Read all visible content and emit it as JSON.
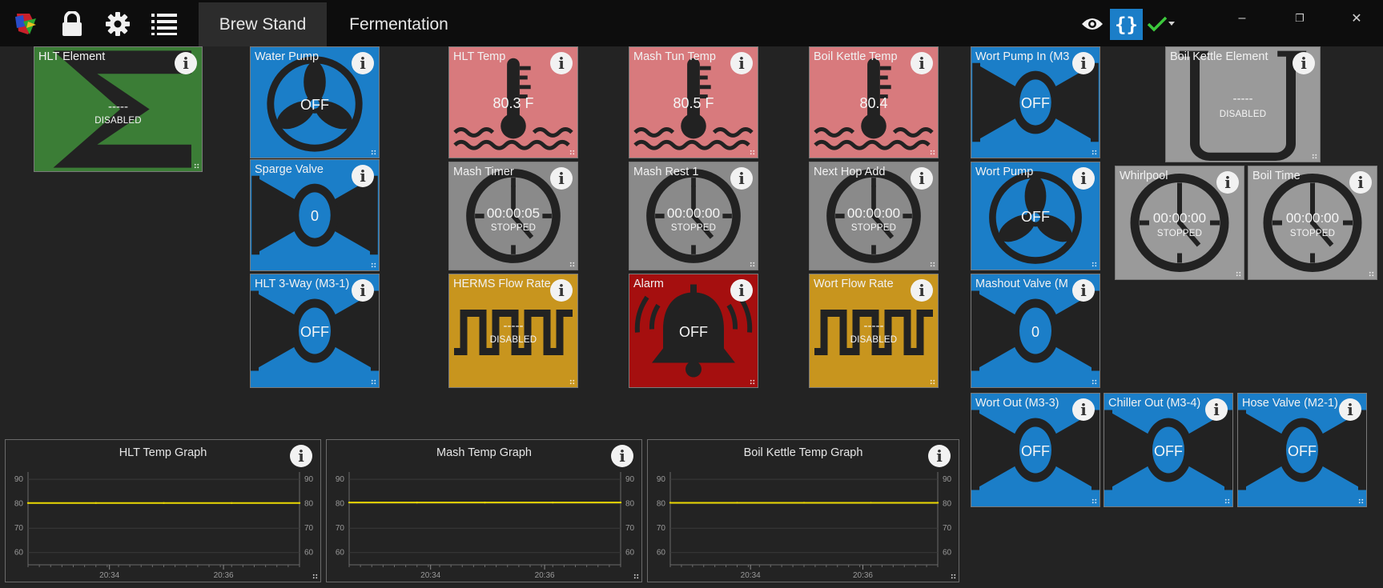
{
  "topbar": {
    "tabs": [
      {
        "label": "Brew Stand",
        "active": true
      },
      {
        "label": "Fermentation",
        "active": false
      }
    ],
    "icons": [
      "app-logo-icon",
      "lock-icon",
      "gear-icon",
      "list-icon",
      "eye-icon",
      "braces-icon",
      "checkmark-icon",
      "caret-down-icon"
    ],
    "window_controls": {
      "minimize": "–",
      "restore": "❐",
      "close": "✕"
    }
  },
  "colors": {
    "blue": "#1b7ec8",
    "pink": "#d87a7d",
    "gray": "#8a8a8a",
    "gold": "#c8951e",
    "red": "#a50f0f",
    "green": "#3b7d36",
    "light_gray": "#9a9a9a",
    "series": "#e8d600"
  },
  "tiles": {
    "hlt_element": {
      "name": "HLT Element",
      "value": "-----",
      "status": "DISABLED"
    },
    "water_pump": {
      "name": "Water Pump",
      "value": "OFF"
    },
    "hlt_temp": {
      "name": "HLT Temp",
      "value": "80.3 F"
    },
    "mash_tun_temp": {
      "name": "Mash Tun Temp",
      "value": "80.5 F"
    },
    "boil_kettle_temp": {
      "name": "Boil Kettle Temp",
      "value": "80.4"
    },
    "wort_pump_in": {
      "name": "Wort Pump In (M3",
      "value": "OFF"
    },
    "boil_kettle_element": {
      "name": "Boil Kettle Element",
      "value": "-----",
      "status": "DISABLED"
    },
    "sparge_valve": {
      "name": "Sparge Valve",
      "value": "0"
    },
    "mash_timer": {
      "name": "Mash Timer",
      "value": "00:00:05",
      "status": "STOPPED"
    },
    "mash_rest_1": {
      "name": "Mash Rest 1",
      "value": "00:00:00",
      "status": "STOPPED"
    },
    "next_hop_add": {
      "name": "Next Hop Add",
      "value": "00:00:00",
      "status": "STOPPED"
    },
    "wort_pump": {
      "name": "Wort Pump",
      "value": "OFF"
    },
    "whirlpool": {
      "name": "Whirlpool",
      "value": "00:00:00",
      "status": "STOPPED"
    },
    "boil_time": {
      "name": "Boil Time",
      "value": "00:00:00",
      "status": "STOPPED"
    },
    "hlt_3way": {
      "name": "HLT 3-Way (M3-1)",
      "value": "OFF"
    },
    "herms_flow_rate": {
      "name": "HERMS Flow Rate",
      "value": "-----",
      "status": "DISABLED"
    },
    "alarm": {
      "name": "Alarm",
      "value": "OFF"
    },
    "wort_flow_rate": {
      "name": "Wort Flow Rate",
      "value": "-----",
      "status": "DISABLED"
    },
    "mashout_valve": {
      "name": "Mashout Valve (M",
      "value": "0"
    },
    "wort_out": {
      "name": "Wort Out (M3-3)",
      "value": "OFF"
    },
    "chiller_out": {
      "name": "Chiller Out (M3-4)",
      "value": "OFF"
    },
    "hose_valve": {
      "name": "Hose Valve (M2-1)",
      "value": "OFF"
    }
  },
  "graphs": [
    {
      "title": "HLT Temp Graph"
    },
    {
      "title": "Mash Temp Graph"
    },
    {
      "title": "Boil Kettle Temp Graph"
    }
  ],
  "chart_data": [
    {
      "type": "line",
      "title": "HLT Temp Graph",
      "xlabel": "",
      "ylabel": "",
      "ylim": [
        55,
        93
      ],
      "y_ticks": [
        90,
        80,
        70,
        60
      ],
      "x_ticks": [
        "20:34",
        "20:36"
      ],
      "series": [
        {
          "values": [
            80.3,
            80.3,
            80.3,
            80.3,
            80.3
          ]
        }
      ]
    },
    {
      "type": "line",
      "title": "Mash Temp Graph",
      "xlabel": "",
      "ylabel": "",
      "ylim": [
        55,
        93
      ],
      "y_ticks": [
        90,
        80,
        70,
        60
      ],
      "x_ticks": [
        "20:34",
        "20:36"
      ],
      "series": [
        {
          "values": [
            80.5,
            80.5,
            80.5,
            80.5,
            80.5
          ]
        }
      ]
    },
    {
      "type": "line",
      "title": "Boil Kettle Temp Graph",
      "xlabel": "",
      "ylabel": "",
      "ylim": [
        55,
        93
      ],
      "y_ticks": [
        90,
        80,
        70,
        60
      ],
      "x_ticks": [
        "20:34",
        "20:36"
      ],
      "series": [
        {
          "values": [
            80.4,
            80.4,
            80.4,
            80.4,
            80.4
          ]
        }
      ]
    }
  ]
}
